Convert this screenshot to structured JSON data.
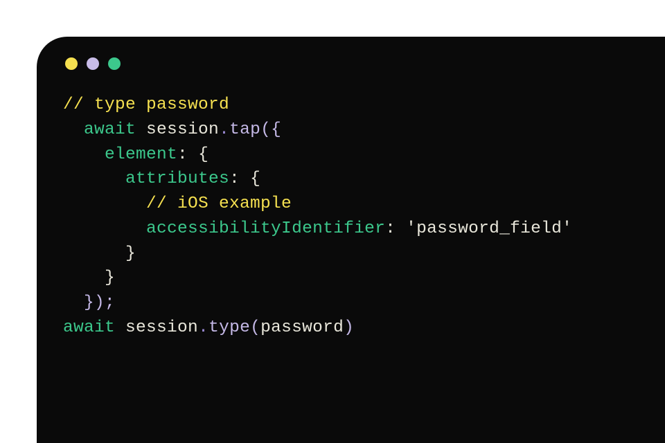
{
  "window": {
    "controls": [
      "yellow",
      "purple",
      "green"
    ]
  },
  "code": {
    "line1_comment": "// type password",
    "line2_await": "await",
    "line2_session": "session",
    "line2_dot": ".",
    "line2_tap": "tap",
    "line2_open": "({",
    "line3_element": "element",
    "line3_colon": ":",
    "line3_brace": " {",
    "line4_attributes": "attributes",
    "line4_colon": ":",
    "line4_brace": " {",
    "line5_comment": "// iOS example",
    "line6_prop": "accessibilityIdentifier",
    "line6_colon": ":",
    "line6_value": " 'password_field'",
    "line7_brace": "}",
    "line8_brace": "}",
    "line9_close": "});",
    "line10_await": "await",
    "line10_session": "session",
    "line10_dot": ".",
    "line10_type": "type",
    "line10_paren_open": "(",
    "line10_arg": "password",
    "line10_paren_close": ")"
  }
}
